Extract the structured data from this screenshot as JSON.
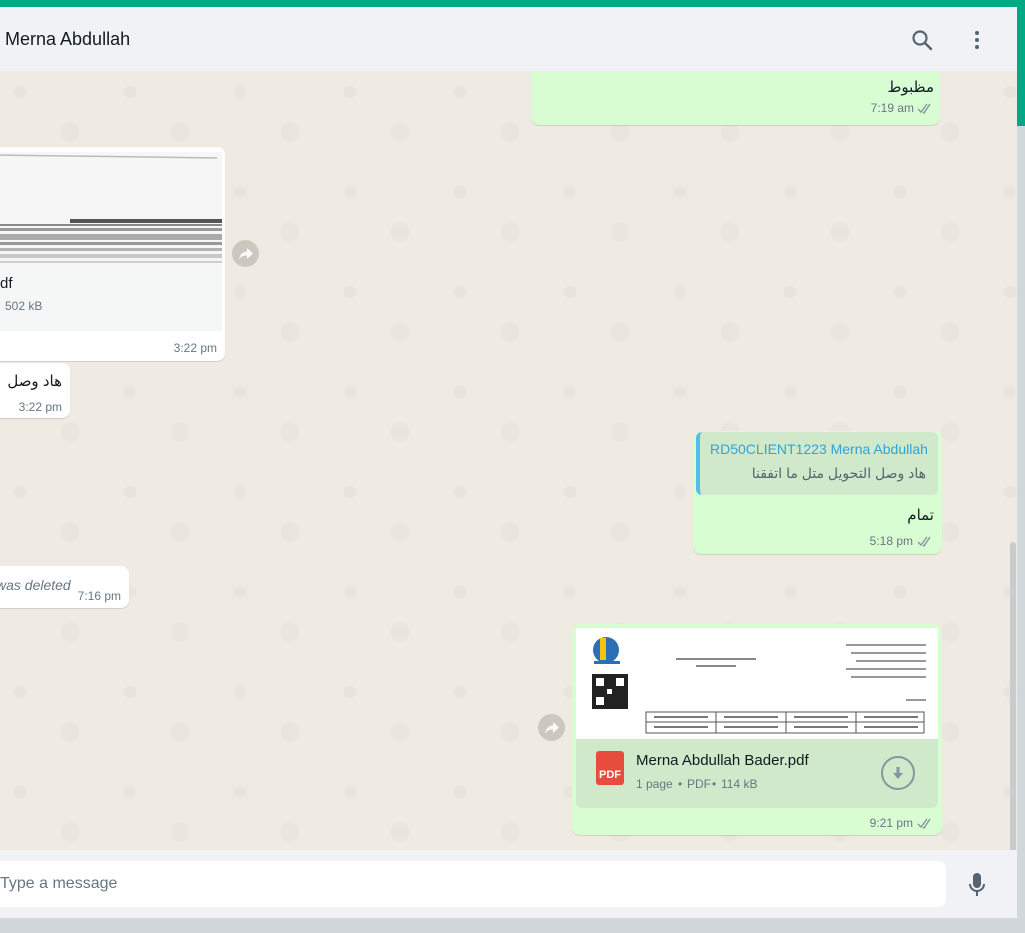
{
  "header": {
    "contact_name": "Merna Abdullah"
  },
  "messages": {
    "m1": {
      "text": "مظبوط",
      "time": "7:19 am"
    },
    "m2": {
      "filename_fragment": "df",
      "size": "502 kB",
      "time": "3:22 pm"
    },
    "m3": {
      "text": "هاد وصل",
      "time": "3:22 pm"
    },
    "m4": {
      "quote_author": "RD50CLIENT1223 Merna Abdullah",
      "quote_text": "هاد وصل التحويل متل ما اتفقنا",
      "text": "تمام",
      "time": "5:18 pm"
    },
    "m5": {
      "text": "was deleted",
      "time": "7:16 pm"
    },
    "m6": {
      "badge": "PDF",
      "filename": "Merna Abdullah Bader.pdf",
      "meta_pages": "1 page",
      "meta_type": "PDF",
      "meta_size": "114 kB",
      "time": "9:21 pm"
    }
  },
  "composer": {
    "placeholder": "Type a message"
  },
  "icons": {
    "search": "search-icon",
    "menu": "menu-icon",
    "forward": "forward-icon",
    "download": "download-icon",
    "mic": "mic-icon",
    "ticks": "double-check-icon",
    "pdf": "pdf-icon"
  },
  "colors": {
    "accent": "#00a884",
    "outgoing_bubble": "#d9fdd3",
    "incoming_bubble": "#ffffff",
    "chat_bg": "#efeae2",
    "read_ticks": "#8696a0",
    "quote_author": "#35a2d8",
    "pdf_red": "#e74c3c"
  }
}
